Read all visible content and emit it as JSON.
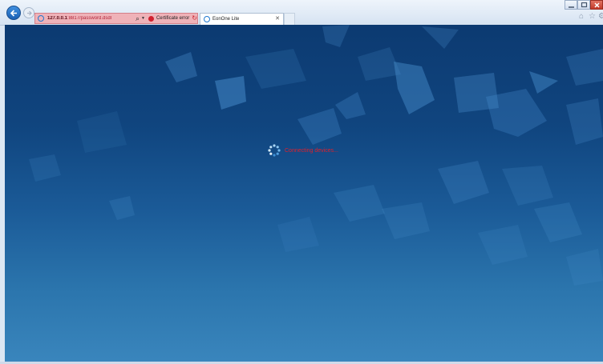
{
  "browser": {
    "address": {
      "host": "127.0.0.1",
      "url_rest": ":8817/password.dsdl",
      "certificate_label": "Certificate error"
    },
    "tabs": [
      {
        "title": "EonOne Lite",
        "active": true
      }
    ]
  },
  "page": {
    "status_text": "Connecting devices...",
    "colors": {
      "accent": "#e0202c",
      "background_top": "#0c3a71",
      "background_bottom": "#3a86bd"
    }
  },
  "icons": [
    "back-icon",
    "forward-icon",
    "ie-icon",
    "search-icon",
    "dropdown-icon",
    "certificate-error-icon",
    "refresh-icon",
    "close-icon",
    "home-icon",
    "favorites-icon",
    "tools-icon",
    "minimize-icon",
    "maximize-icon",
    "spinner-icon"
  ]
}
